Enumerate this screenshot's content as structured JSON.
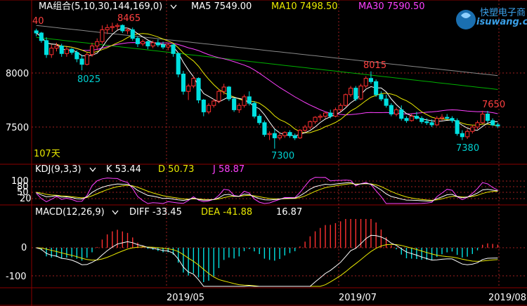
{
  "header": {
    "ma_group_label": "MA组合(5,10,30,144,169,0)",
    "ma5": "MA5 7549.00",
    "ma10": "MA10 7498.50",
    "ma30": "MA30 7590.50",
    "colors": {
      "ma5": "#ffffff",
      "ma10": "#e8e800",
      "ma30": "#ff40ff"
    }
  },
  "logo": {
    "name": "快塑电子商",
    "domain": "isuwang.co"
  },
  "price_panel": {
    "period_label": "107天",
    "annotations": [
      {
        "text": "40",
        "color": "#ff4040"
      },
      {
        "text": "8465",
        "color": "#ff4040"
      },
      {
        "text": "8025",
        "color": "#00d0d0"
      },
      {
        "text": "8015",
        "color": "#ff4040"
      },
      {
        "text": "7300",
        "color": "#00d0d0"
      },
      {
        "text": "7650",
        "color": "#ff4040"
      },
      {
        "text": "7380",
        "color": "#00d0d0"
      }
    ]
  },
  "kdj_panel": {
    "label": "KDJ(9,3,3)",
    "k": "K 53.44",
    "d": "D 50.73",
    "j": "J 58.87",
    "colors": {
      "k": "#ffffff",
      "d": "#e8e800",
      "j": "#ff40ff"
    }
  },
  "macd_panel": {
    "label": "MACD(12,26,9)",
    "diff": "DIFF -33.45",
    "dea": "DEA -41.88",
    "macd": "16.87",
    "colors": {
      "diff": "#ffffff",
      "dea": "#e8e800",
      "macd": "#ffffff"
    }
  },
  "x_axis": {
    "ticks": [
      "2019/05",
      "2019/07",
      "2019/08"
    ]
  },
  "chart_data": [
    {
      "type": "candlestick",
      "title": "",
      "y_ticks": [
        8000,
        7500
      ],
      "ylim": [
        7200,
        8600
      ],
      "bars": [
        [
          8390,
          8410,
          8340,
          8370
        ],
        [
          8370,
          8380,
          8280,
          8300
        ],
        [
          8300,
          8330,
          8140,
          8170
        ],
        [
          8170,
          8260,
          8140,
          8230
        ],
        [
          8230,
          8280,
          8200,
          8250
        ],
        [
          8250,
          8270,
          8150,
          8180
        ],
        [
          8180,
          8240,
          8150,
          8220
        ],
        [
          8220,
          8230,
          8170,
          8190
        ],
        [
          8190,
          8210,
          8100,
          8130
        ],
        [
          8130,
          8170,
          8025,
          8080
        ],
        [
          8080,
          8190,
          8070,
          8170
        ],
        [
          8170,
          8280,
          8150,
          8250
        ],
        [
          8250,
          8320,
          8210,
          8290
        ],
        [
          8290,
          8440,
          8270,
          8400
        ],
        [
          8400,
          8450,
          8360,
          8420
        ],
        [
          8420,
          8465,
          8380,
          8430
        ],
        [
          8430,
          8460,
          8400,
          8440
        ],
        [
          8440,
          8450,
          8370,
          8390
        ],
        [
          8390,
          8420,
          8360,
          8400
        ],
        [
          8400,
          8420,
          8300,
          8320
        ],
        [
          8320,
          8340,
          8240,
          8270
        ],
        [
          8270,
          8310,
          8250,
          8290
        ],
        [
          8290,
          8300,
          8220,
          8250
        ],
        [
          8250,
          8300,
          8230,
          8280
        ],
        [
          8280,
          8310,
          8240,
          8260
        ],
        [
          8260,
          8290,
          8220,
          8240
        ],
        [
          8240,
          8280,
          8210,
          8260
        ],
        [
          8260,
          8270,
          8150,
          8180
        ],
        [
          8180,
          8190,
          7960,
          7990
        ],
        [
          7990,
          8020,
          7800,
          7830
        ],
        [
          7830,
          7900,
          7750,
          7880
        ],
        [
          7880,
          7970,
          7860,
          7950
        ],
        [
          7950,
          7960,
          7720,
          7750
        ],
        [
          7750,
          7760,
          7600,
          7640
        ],
        [
          7640,
          7720,
          7620,
          7700
        ],
        [
          7700,
          7760,
          7680,
          7740
        ],
        [
          7740,
          7850,
          7720,
          7830
        ],
        [
          7830,
          7900,
          7800,
          7870
        ],
        [
          7870,
          7880,
          7740,
          7760
        ],
        [
          7760,
          7770,
          7640,
          7660
        ],
        [
          7660,
          7720,
          7630,
          7700
        ],
        [
          7700,
          7800,
          7680,
          7780
        ],
        [
          7780,
          7830,
          7700,
          7720
        ],
        [
          7720,
          7740,
          7580,
          7600
        ],
        [
          7600,
          7620,
          7520,
          7540
        ],
        [
          7540,
          7560,
          7410,
          7430
        ],
        [
          7430,
          7460,
          7380,
          7440
        ],
        [
          7440,
          7480,
          7300,
          7400
        ],
        [
          7400,
          7450,
          7380,
          7420
        ],
        [
          7420,
          7460,
          7400,
          7450
        ],
        [
          7450,
          7470,
          7400,
          7420
        ],
        [
          7420,
          7440,
          7380,
          7400
        ],
        [
          7400,
          7480,
          7390,
          7470
        ],
        [
          7470,
          7520,
          7450,
          7500
        ],
        [
          7500,
          7560,
          7480,
          7550
        ],
        [
          7550,
          7600,
          7530,
          7590
        ],
        [
          7590,
          7620,
          7560,
          7600
        ],
        [
          7600,
          7640,
          7580,
          7630
        ],
        [
          7630,
          7660,
          7580,
          7600
        ],
        [
          7600,
          7680,
          7590,
          7660
        ],
        [
          7660,
          7720,
          7640,
          7700
        ],
        [
          7700,
          7810,
          7690,
          7800
        ],
        [
          7800,
          7880,
          7780,
          7860
        ],
        [
          7860,
          7880,
          7740,
          7760
        ],
        [
          7760,
          7900,
          7750,
          7880
        ],
        [
          7880,
          7970,
          7860,
          7950
        ],
        [
          7950,
          8015,
          7900,
          7920
        ],
        [
          7920,
          7940,
          7780,
          7800
        ],
        [
          7800,
          7830,
          7740,
          7760
        ],
        [
          7760,
          7800,
          7680,
          7700
        ],
        [
          7700,
          7720,
          7600,
          7620
        ],
        [
          7620,
          7680,
          7600,
          7660
        ],
        [
          7660,
          7700,
          7560,
          7580
        ],
        [
          7580,
          7600,
          7540,
          7560
        ],
        [
          7560,
          7620,
          7550,
          7600
        ],
        [
          7600,
          7640,
          7570,
          7580
        ],
        [
          7580,
          7600,
          7530,
          7550
        ],
        [
          7550,
          7580,
          7520,
          7540
        ],
        [
          7540,
          7570,
          7500,
          7520
        ],
        [
          7520,
          7600,
          7510,
          7580
        ],
        [
          7580,
          7620,
          7560,
          7590
        ],
        [
          7590,
          7620,
          7570,
          7580
        ],
        [
          7580,
          7600,
          7540,
          7560
        ],
        [
          7560,
          7580,
          7420,
          7440
        ],
        [
          7440,
          7470,
          7380,
          7410
        ],
        [
          7410,
          7480,
          7390,
          7460
        ],
        [
          7460,
          7520,
          7440,
          7500
        ],
        [
          7500,
          7560,
          7480,
          7540
        ],
        [
          7540,
          7650,
          7530,
          7620
        ],
        [
          7620,
          7650,
          7540,
          7560
        ],
        [
          7560,
          7580,
          7510,
          7520
        ],
        [
          7520,
          7540,
          7490,
          7510
        ]
      ]
    },
    {
      "type": "line",
      "title": "",
      "series_names": [
        "K",
        "D",
        "J"
      ],
      "y_ticks": [
        100,
        80,
        50,
        20
      ],
      "ylim": [
        -10,
        110
      ]
    },
    {
      "type": "bar+line",
      "title": "",
      "series_names": [
        "DIFF",
        "DEA",
        "MACD"
      ],
      "y_ticks": [
        0,
        -100
      ],
      "ylim": [
        -140,
        95
      ]
    }
  ]
}
